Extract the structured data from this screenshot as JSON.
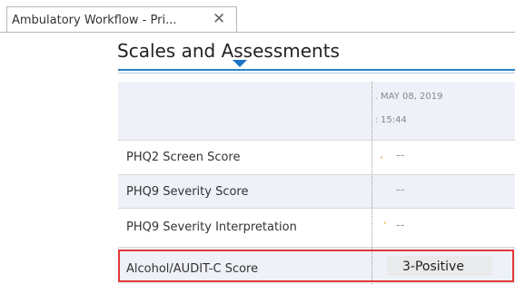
{
  "tab": {
    "label": "Ambulatory Workflow - Pri...",
    "close_glyph": "✕"
  },
  "section": {
    "title": "Scales and Assessments"
  },
  "column": {
    "date": "MAY 08, 2019",
    "time": "15:44"
  },
  "rows": [
    {
      "label": "PHQ2 Screen Score",
      "value": "--"
    },
    {
      "label": "PHQ9 Severity Score",
      "value": "--"
    },
    {
      "label": "PHQ9 Severity Interpretation",
      "value": "--"
    },
    {
      "label": "Alcohol/AUDIT-C Score",
      "value": "3-Positive"
    }
  ],
  "colors": {
    "accent_blue": "#2a82c9",
    "highlight_red": "#e23a3a",
    "alt_row": "#eff1f8"
  }
}
